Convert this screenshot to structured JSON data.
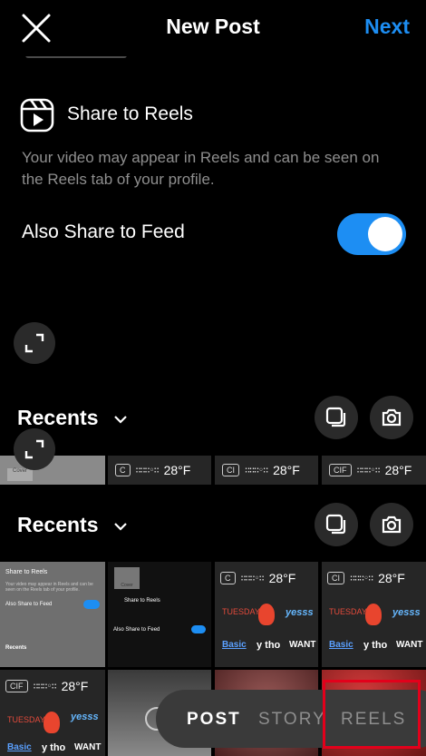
{
  "header": {
    "title": "New Post",
    "next_label": "Next"
  },
  "reels": {
    "title": "Share to Reels",
    "description": "Your video may appear in Reels and can be seen on the Reels tab of your profile.",
    "feed_label": "Also Share to Feed",
    "feed_toggle_on": true
  },
  "gallery": {
    "recents_label": "Recents",
    "weather": {
      "temp": "28°F",
      "chips": [
        "C",
        "CI",
        "CIF"
      ]
    },
    "stickers": {
      "day": "TUESDAY",
      "yes": "yesss",
      "basic": "Basic",
      "ytho": "y tho",
      "want": "WANT"
    },
    "thumb_cover": "Cover"
  },
  "modes": {
    "post": "POST",
    "story": "STORY",
    "reels": "REELS"
  },
  "colors": {
    "accent": "#1d8ef3",
    "highlight": "#e3001b"
  }
}
